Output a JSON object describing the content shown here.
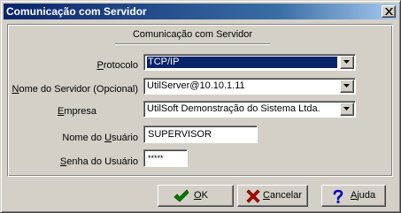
{
  "window": {
    "title": "Comunicação com Servidor"
  },
  "group": {
    "title": "Comunicação com Servidor"
  },
  "fields": {
    "protocolo": {
      "label": "Protocolo",
      "mnemonic": "P",
      "rest": "rotocolo",
      "value": "TCP/IP"
    },
    "servidor": {
      "label": "Nome do Servidor (Opcional)",
      "mnemonic": "N",
      "rest": "ome do Servidor (Opcional)",
      "value": "UtilServer@10.10.1.11"
    },
    "empresa": {
      "label": "Empresa",
      "mnemonic": "E",
      "rest": "mpresa",
      "value": "UtilSoft Demonstração do Sistema Ltda."
    },
    "usuario": {
      "label": "Nome do Usuário",
      "prefix": "Nome do ",
      "mnemonic": "U",
      "rest": "suário",
      "value": "SUPERVISOR"
    },
    "senha": {
      "label": "Senha do Usuário",
      "mnemonic": "S",
      "rest": "enha do Usuário",
      "value": "*****"
    }
  },
  "buttons": {
    "ok": {
      "mnemonic": "O",
      "rest": "K",
      "icon": "check-icon",
      "color": "#008000"
    },
    "cancelar": {
      "mnemonic": "C",
      "rest": "ancelar",
      "icon": "x-icon",
      "color": "#c00000"
    },
    "ajuda": {
      "mnemonic": "A",
      "rest": "juda",
      "icon": "question-icon",
      "color": "#0000c0"
    }
  }
}
